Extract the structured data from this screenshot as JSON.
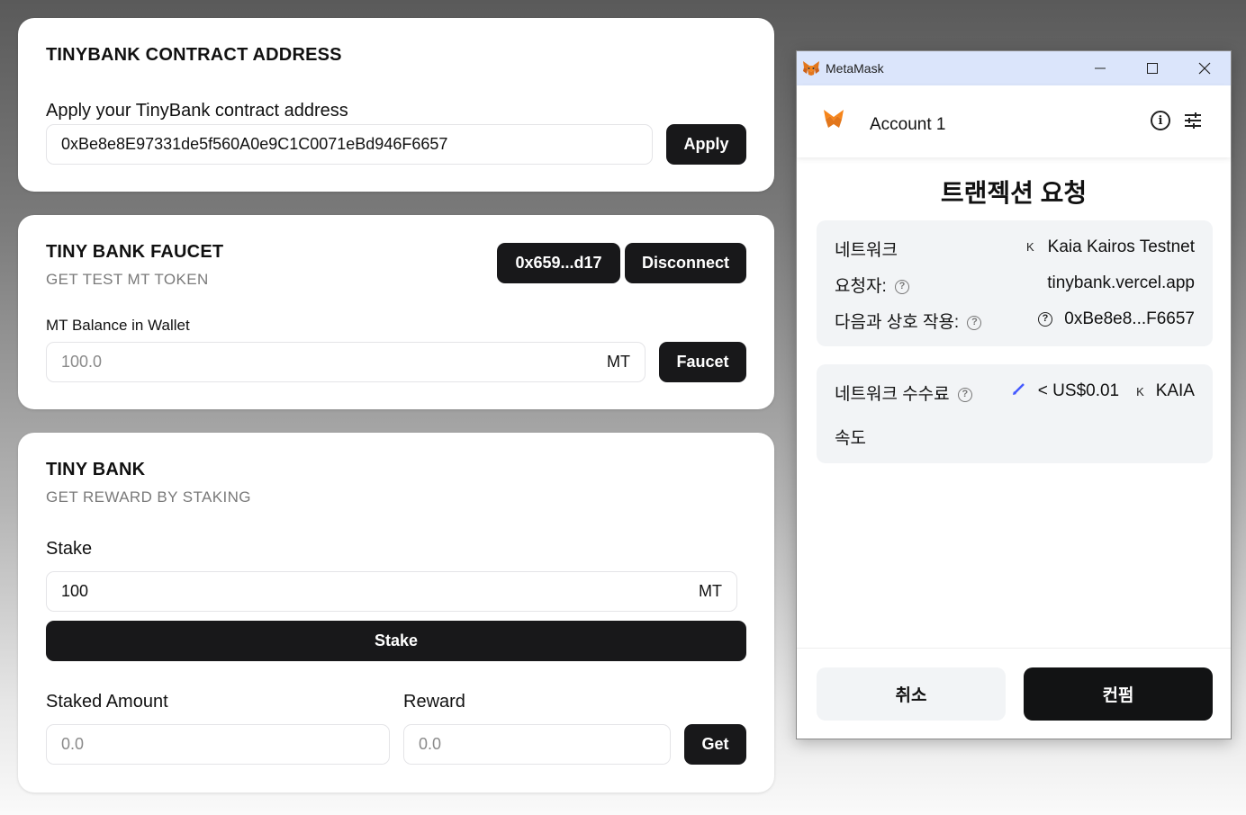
{
  "contract_card": {
    "title": "TINYBANK CONTRACT ADDRESS",
    "field_label": "Apply your TinyBank contract address",
    "address_value": "0xBe8e8E97331de5f560A0e9C1C0071eBd946F6657",
    "apply_label": "Apply"
  },
  "faucet_card": {
    "title": "TINY BANK FAUCET",
    "subtitle": "GET TEST MT TOKEN",
    "account_label": "0x659...d17",
    "disconnect_label": "Disconnect",
    "balance_label": "MT Balance in Wallet",
    "balance_value": "100.0",
    "balance_unit": "MT",
    "faucet_label": "Faucet"
  },
  "bank_card": {
    "title": "TINY BANK",
    "subtitle": "GET REWARD BY STAKING",
    "stake_label": "Stake",
    "stake_value": "100",
    "stake_unit": "MT",
    "stake_button": "Stake",
    "staked_amount_label": "Staked Amount",
    "staked_amount_value": "0.0",
    "reward_label": "Reward",
    "reward_value": "0.0",
    "get_label": "Get"
  },
  "metamask": {
    "window_title": "MetaMask",
    "account_name": "Account 1",
    "heading": "트랜젝션 요청",
    "network_label": "네트워크",
    "network_icon": "K",
    "network_value": "Kaia Kairos Testnet",
    "requester_label": "요청자:",
    "requester_value": "tinybank.vercel.app",
    "interact_label": "다음과 상호 작용:",
    "interact_value": "0xBe8e8...F6657",
    "fee_label": "네트워크 수수료",
    "fee_value": "< US$0.01",
    "fee_token_icon": "K",
    "fee_token": "KAIA",
    "speed_label": "속도",
    "cancel_label": "취소",
    "confirm_label": "컨펌",
    "icons": [
      "fox-icon",
      "minimize-icon",
      "maximize-icon",
      "close-icon",
      "info-icon",
      "settings-sliders-icon",
      "help-icon",
      "edit-pencil-icon"
    ],
    "accent_color": "#f6851b",
    "pencil_color": "#4459ff"
  }
}
